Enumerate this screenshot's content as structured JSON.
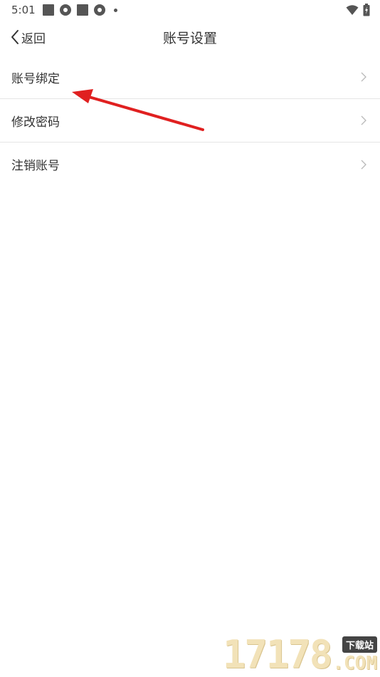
{
  "status_bar": {
    "time": "5:01",
    "left_icons": [
      "square-notification-icon",
      "ring-notification-icon",
      "square-notification-icon",
      "ring-notification-icon",
      "more-dot-icon"
    ],
    "right_icons": [
      "wifi-icon",
      "battery-charging-icon"
    ]
  },
  "nav": {
    "back_label": "返回",
    "title": "账号设置"
  },
  "settings": {
    "items": [
      {
        "label": "账号绑定"
      },
      {
        "label": "修改密码"
      },
      {
        "label": "注销账号"
      }
    ]
  },
  "annotation": {
    "color": "#e02020"
  },
  "watermark": {
    "digits": "17178",
    "badge": "下载站",
    "suffix": ".COM"
  }
}
